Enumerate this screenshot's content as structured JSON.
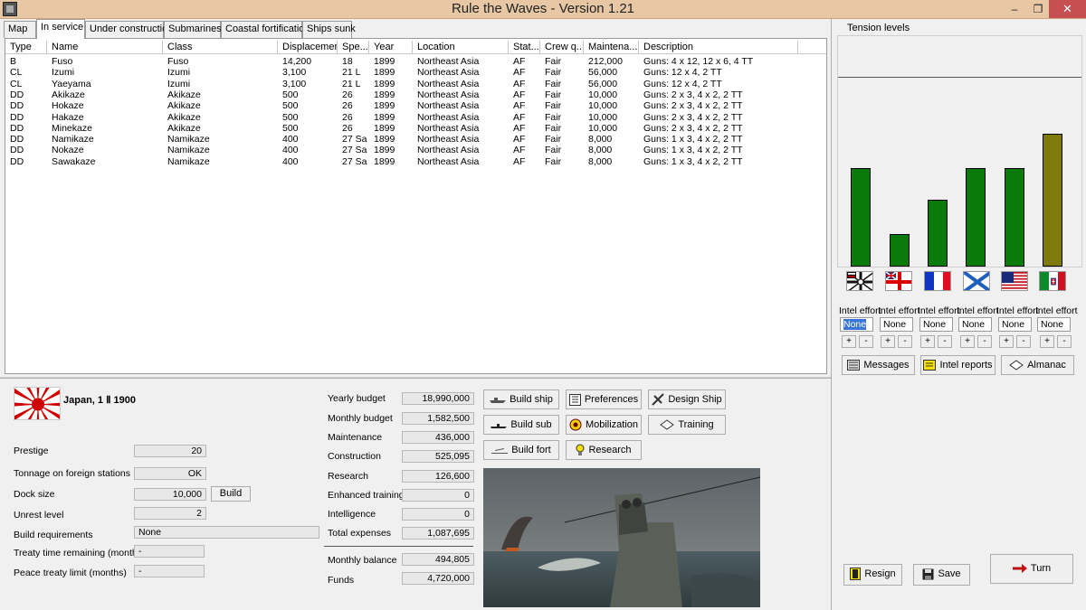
{
  "window": {
    "title": "Rule the Waves - Version 1.21",
    "min": "–",
    "max": "❐",
    "close": "✕"
  },
  "tabs": [
    "Map",
    "In service",
    "Under construction",
    "Submarines",
    "Coastal fortifications",
    "Ships sunk"
  ],
  "grid": {
    "columns": [
      "Type",
      "Name",
      "Class",
      "Displacement",
      "Spe...",
      "Year",
      "Location",
      "Stat...",
      "Crew q...",
      "Maintena...",
      "Description"
    ],
    "rows": [
      [
        "B",
        "Fuso",
        "Fuso",
        "14,200",
        "18",
        "1899",
        "Northeast Asia",
        "AF",
        "Fair",
        "212,000",
        "Guns: 4 x 12, 12 x 6, 4 TT"
      ],
      [
        "CL",
        "Izumi",
        "Izumi",
        "3,100",
        "21 L",
        "1899",
        "Northeast Asia",
        "AF",
        "Fair",
        "56,000",
        "Guns: 12 x 4, 2 TT"
      ],
      [
        "CL",
        "Yaeyama",
        "Izumi",
        "3,100",
        "21 L",
        "1899",
        "Northeast Asia",
        "AF",
        "Fair",
        "56,000",
        "Guns: 12 x 4, 2 TT"
      ],
      [
        "DD",
        "Akikaze",
        "Akikaze",
        "500",
        "26",
        "1899",
        "Northeast Asia",
        "AF",
        "Fair",
        "10,000",
        "Guns: 2 x 3, 4 x 2, 2 TT"
      ],
      [
        "DD",
        "Hokaze",
        "Akikaze",
        "500",
        "26",
        "1899",
        "Northeast Asia",
        "AF",
        "Fair",
        "10,000",
        "Guns: 2 x 3, 4 x 2, 2 TT"
      ],
      [
        "DD",
        "Hakaze",
        "Akikaze",
        "500",
        "26",
        "1899",
        "Northeast Asia",
        "AF",
        "Fair",
        "10,000",
        "Guns: 2 x 3, 4 x 2, 2 TT"
      ],
      [
        "DD",
        "Minekaze",
        "Akikaze",
        "500",
        "26",
        "1899",
        "Northeast Asia",
        "AF",
        "Fair",
        "10,000",
        "Guns: 2 x 3, 4 x 2, 2 TT"
      ],
      [
        "DD",
        "Namikaze",
        "Namikaze",
        "400",
        "27 Sa",
        "1899",
        "Northeast Asia",
        "AF",
        "Fair",
        "8,000",
        "Guns: 1 x 3, 4 x 2, 2 TT"
      ],
      [
        "DD",
        "Nokaze",
        "Namikaze",
        "400",
        "27 Sa",
        "1899",
        "Northeast Asia",
        "AF",
        "Fair",
        "8,000",
        "Guns: 1 x 3, 4 x 2, 2 TT"
      ],
      [
        "DD",
        "Sawakaze",
        "Namikaze",
        "400",
        "27 Sa",
        "1899",
        "Northeast Asia",
        "AF",
        "Fair",
        "8,000",
        "Guns: 1 x 3, 4 x 2, 2 TT"
      ]
    ]
  },
  "nation": {
    "title": "Japan, 1 Ⅱ 1900"
  },
  "stats": {
    "prestige_label": "Prestige",
    "prestige": "20",
    "tonnage_label": "Tonnage on foreign stations",
    "tonnage": "OK",
    "dock_label": "Dock size",
    "dock": "10,000",
    "build_label": "Build",
    "unrest_label": "Unrest level",
    "unrest": "2",
    "build_req_label": "Build requirements",
    "build_req": "None",
    "treaty_label": "Treaty time remaining (months)",
    "treaty": "-",
    "peace_label": "Peace treaty limit (months)",
    "peace": "-"
  },
  "budget": {
    "yearly_label": "Yearly budget",
    "yearly": "18,990,000",
    "monthly_label": "Monthly budget",
    "monthly": "1,582,500",
    "maint_label": "Maintenance",
    "maint": "436,000",
    "constr_label": "Construction",
    "constr": "525,095",
    "research_label": "Research",
    "research": "126,600",
    "training_label": "Enhanced training",
    "training": "0",
    "intel_label": "Intelligence",
    "intel": "0",
    "total_label": "Total expenses",
    "total": "1,087,695",
    "balance_label": "Monthly balance",
    "balance": "494,805",
    "funds_label": "Funds",
    "funds": "4,720,000"
  },
  "actions": {
    "build_ship": "Build ship",
    "preferences": "Preferences",
    "design_ship": "Design Ship",
    "build_sub": "Build sub",
    "mobilization": "Mobilization",
    "training": "Training",
    "build_fort": "Build fort",
    "research": "Research"
  },
  "tension": {
    "label": "Tension levels",
    "nations": [
      {
        "flag": "germany-flag",
        "level": 0.52,
        "color": "#0a7a0a"
      },
      {
        "flag": "britain-flag",
        "level": 0.17,
        "color": "#0a7a0a"
      },
      {
        "flag": "france-flag",
        "level": 0.35,
        "color": "#0a7a0a"
      },
      {
        "flag": "russia-flag",
        "level": 0.52,
        "color": "#0a7a0a"
      },
      {
        "flag": "usa-flag",
        "level": 0.52,
        "color": "#0a7a0a"
      },
      {
        "flag": "italy-flag",
        "level": 0.7,
        "color": "#807a0a"
      }
    ]
  },
  "intel": {
    "label": "Intel effort",
    "value": "None",
    "plus": "+",
    "minus": "-"
  },
  "side_buttons": {
    "messages": "Messages",
    "intel_reports": "Intel reports",
    "almanac": "Almanac"
  },
  "bottom_buttons": {
    "resign": "Resign",
    "save": "Save",
    "turn": "Turn"
  }
}
